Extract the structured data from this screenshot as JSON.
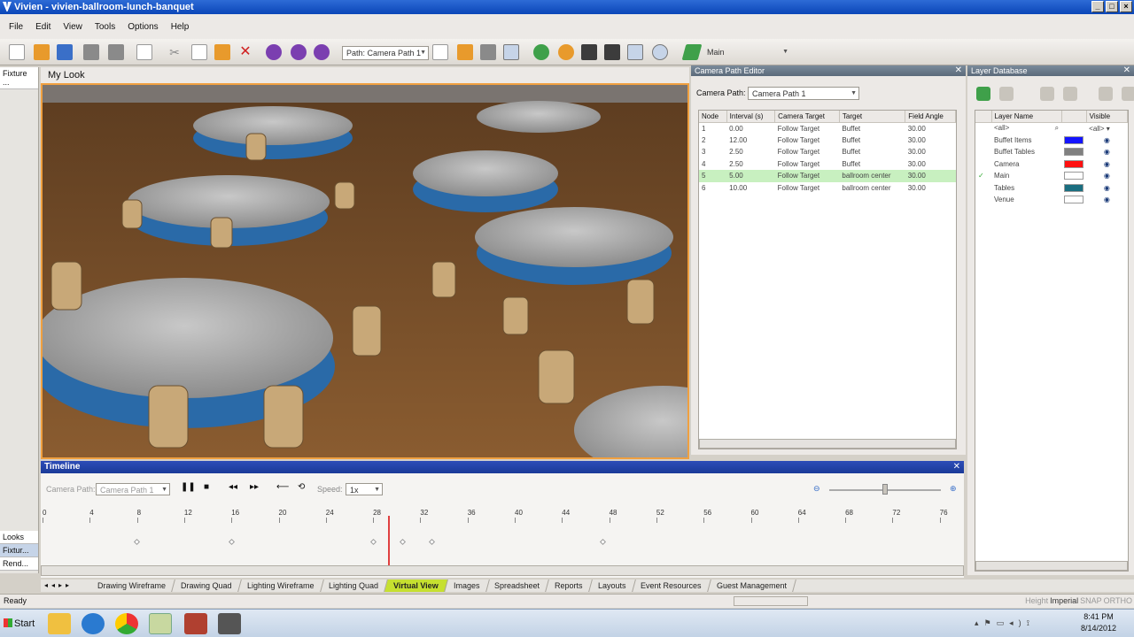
{
  "window": {
    "title": "Vivien - vivien-ballroom-lunch-banquet"
  },
  "menu": [
    "File",
    "Edit",
    "View",
    "Tools",
    "Options",
    "Help"
  ],
  "toolbar": {
    "path_dropdown": "Path: Camera Path 1",
    "layer_dropdown": "Main"
  },
  "left_panel": {
    "top_tab": "Fixture ...",
    "bottom_tabs": [
      "Looks",
      "Fixtur...",
      "Rend..."
    ]
  },
  "viewport": {
    "title": "My Look"
  },
  "camera_path_editor": {
    "title": "Camera Path Editor",
    "camera_path_label": "Camera Path:",
    "camera_path_value": "Camera Path 1",
    "columns": [
      "Node",
      "Interval (s)",
      "Camera Target",
      "Target",
      "Field Angle"
    ],
    "rows": [
      [
        "1",
        "0.00",
        "Follow Target",
        "Buffet",
        "30.00"
      ],
      [
        "2",
        "12.00",
        "Follow Target",
        "Buffet",
        "30.00"
      ],
      [
        "3",
        "2.50",
        "Follow Target",
        "Buffet",
        "30.00"
      ],
      [
        "4",
        "2.50",
        "Follow Target",
        "Buffet",
        "30.00"
      ],
      [
        "5",
        "5.00",
        "Follow Target",
        "ballroom center",
        "30.00"
      ],
      [
        "6",
        "10.00",
        "Follow Target",
        "ballroom center",
        "30.00"
      ]
    ],
    "selected_row": 4
  },
  "layer_database": {
    "title": "Layer Database",
    "columns": [
      "Layer Name",
      "Visible"
    ],
    "filter_name": "<all>",
    "filter_visible": "<all>",
    "layers": [
      {
        "name": "Buffet Items",
        "color": "#1414ff",
        "active": false
      },
      {
        "name": "Buffet Tables",
        "color": "#808080",
        "active": false
      },
      {
        "name": "Camera",
        "color": "#ff1010",
        "active": false
      },
      {
        "name": "Main",
        "color": "#ffffff",
        "active": true
      },
      {
        "name": "Tables",
        "color": "#1a6e80",
        "active": false
      },
      {
        "name": "Venue",
        "color": "#ffffff",
        "active": false
      }
    ]
  },
  "timeline": {
    "title": "Timeline",
    "camera_path_label": "Camera Path:",
    "camera_path_value": "Camera Path 1",
    "speed_label": "Speed:",
    "speed_value": "1x",
    "ticks": [
      "0",
      "4",
      "8",
      "12",
      "16",
      "20",
      "24",
      "28",
      "32",
      "36",
      "40",
      "44",
      "48",
      "52",
      "56",
      "60",
      "64",
      "68",
      "72",
      "76"
    ],
    "playhead": 29.6,
    "keyframes": [
      0,
      8,
      20,
      22.5,
      25,
      39.5
    ]
  },
  "bottom_tabs": [
    "Drawing Wireframe",
    "Drawing Quad",
    "Lighting Wireframe",
    "Lighting Quad",
    "Virtual View",
    "Images",
    "Spreadsheet",
    "Reports",
    "Layouts",
    "Event Resources",
    "Guest Management"
  ],
  "active_bottom_tab": "Virtual View",
  "status": {
    "left": "Ready",
    "right": [
      "Height",
      "Imperial",
      "SNAP",
      "ORTHO"
    ]
  },
  "taskbar": {
    "start": "Start",
    "time": "8:41 PM",
    "date": "8/14/2012"
  }
}
